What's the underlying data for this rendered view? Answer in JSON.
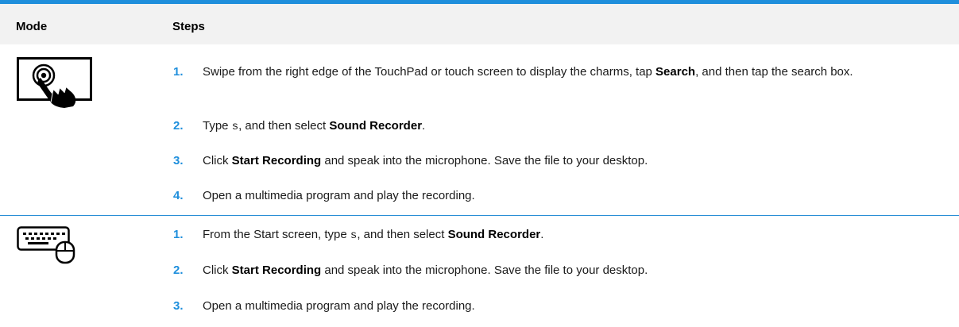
{
  "header": {
    "mode_label": "Mode",
    "steps_label": "Steps"
  },
  "rows": [
    {
      "mode_icon": "touch-gesture-icon",
      "steps": [
        {
          "num": "1.",
          "segments": [
            {
              "t": "Swipe from the right edge of the TouchPad or touch screen to display the charms, tap "
            },
            {
              "t": "Search",
              "b": true
            },
            {
              "t": ", and then tap the search box."
            }
          ]
        },
        {
          "num": "2.",
          "segments": [
            {
              "t": "Type "
            },
            {
              "t": "s",
              "code": true
            },
            {
              "t": ", and then select "
            },
            {
              "t": "Sound Recorder",
              "b": true
            },
            {
              "t": "."
            }
          ]
        },
        {
          "num": "3.",
          "segments": [
            {
              "t": "Click "
            },
            {
              "t": "Start Recording",
              "b": true
            },
            {
              "t": " and speak into the microphone. Save the file to your desktop."
            }
          ]
        },
        {
          "num": "4.",
          "segments": [
            {
              "t": "Open a multimedia program and play the recording."
            }
          ]
        }
      ]
    },
    {
      "mode_icon": "keyboard-mouse-icon",
      "steps": [
        {
          "num": "1.",
          "segments": [
            {
              "t": "From the Start screen, type "
            },
            {
              "t": "s",
              "code": true
            },
            {
              "t": ", and then select "
            },
            {
              "t": "Sound Recorder",
              "b": true
            },
            {
              "t": "."
            }
          ]
        },
        {
          "num": "2.",
          "segments": [
            {
              "t": "Click "
            },
            {
              "t": "Start Recording",
              "b": true
            },
            {
              "t": " and speak into the microphone. Save the file to your desktop."
            }
          ]
        },
        {
          "num": "3.",
          "segments": [
            {
              "t": "Open a multimedia program and play the recording."
            }
          ]
        }
      ]
    }
  ],
  "colors": {
    "accent": "#1f8fdc",
    "header_bg": "#f2f2f2"
  }
}
